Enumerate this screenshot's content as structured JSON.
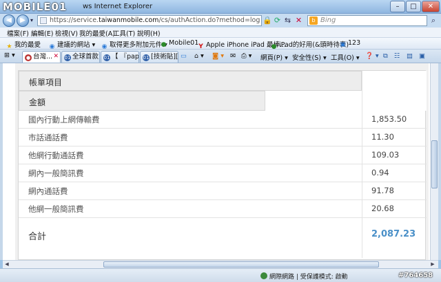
{
  "window": {
    "logo": "MOBILE01",
    "title": "ws Internet Explorer",
    "min": "–",
    "max": "□",
    "close": "✕"
  },
  "address": {
    "url_prefix": "https://service.",
    "url_domain": "taiwanmobile.com",
    "url_rest": "/cs/authAction.do?method=login&forward_url=%",
    "search_placeholder": "Bing"
  },
  "menu": [
    "檔案(F)",
    "編輯(E)",
    "檢視(V)",
    "我的最愛(A)",
    "工具(T)",
    "說明(H)"
  ],
  "favorites": [
    "我的最愛",
    "建議的網站 ▾",
    "取得更多附加元件 ▾",
    "Mobile01",
    "Apple iPhone iPad 最棒...",
    "iPad的好用(&頭時待表)",
    "123"
  ],
  "tabs": [
    "台灣...",
    "全球首款...",
    "【 『pap...",
    "[技術貼][..."
  ],
  "commands": [
    "網頁(P) ▾",
    "安全性(S) ▾",
    "工具(O) ▾",
    "❓ ▾"
  ],
  "bill": {
    "header_item": "帳單項目",
    "header_amount": "金額",
    "rows": [
      {
        "label": "國內行動上網傳輸費",
        "value": "1,853.50"
      },
      {
        "label": "市話通話費",
        "value": "11.30"
      },
      {
        "label": "他網行動通話費",
        "value": "109.03"
      },
      {
        "label": "網內一般簡訊費",
        "value": "0.94"
      },
      {
        "label": "網內通話費",
        "value": "91.78"
      },
      {
        "label": "他網一般簡訊費",
        "value": "20.68"
      }
    ],
    "total_label": "合計",
    "total_value": "2,087.23"
  },
  "status": {
    "zone": "網際網路 | 受保護模式: 啟動",
    "watermark": "#764658"
  },
  "colors": {
    "total_accent": "#4a90c8",
    "header_bg": "#ededed"
  }
}
